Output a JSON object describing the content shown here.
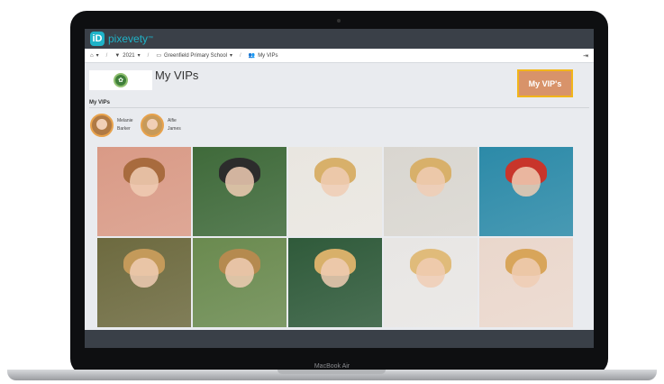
{
  "app": {
    "logo_text": "pixevety",
    "logo_tm": "™",
    "logo_mark": "iD"
  },
  "breadcrumb": {
    "year": "2021",
    "school": "Greenfield Primary School",
    "page": "My VIPs"
  },
  "header": {
    "title": "My VIPs",
    "school_logo_label": "school-crest"
  },
  "vip_button": {
    "label": "My VIP's"
  },
  "section": {
    "label": "My VIPs"
  },
  "vips": [
    {
      "first": "Melanie",
      "last": "Barker"
    },
    {
      "first": "Alfie",
      "last": "James"
    }
  ],
  "photos": [
    {
      "bg": "#d99a86",
      "hair": "#a86b3e"
    },
    {
      "bg": "#3f6a3a",
      "hair": "#2c2c2c"
    },
    {
      "bg": "#e9e6e0",
      "hair": "#d8b06a"
    },
    {
      "bg": "#d9d6d0",
      "hair": "#d8b06a"
    },
    {
      "bg": "#2c8aa8",
      "hair": "#c8352b"
    },
    {
      "bg": "#6d6a3f",
      "hair": "#c49a5a"
    },
    {
      "bg": "#6a8a4f",
      "hair": "#b58a4f"
    },
    {
      "bg": "#2f5a3a",
      "hair": "#d8b06a"
    },
    {
      "bg": "#e8e6e4",
      "hair": "#e0bb7a"
    },
    {
      "bg": "#ead7cc",
      "hair": "#d8a55a"
    }
  ],
  "colors": {
    "accent": "#1fb3c8",
    "button": "#d8936a",
    "button_border": "#f2b51a",
    "topbar": "#3a4048"
  },
  "device": {
    "label": "MacBook Air"
  }
}
